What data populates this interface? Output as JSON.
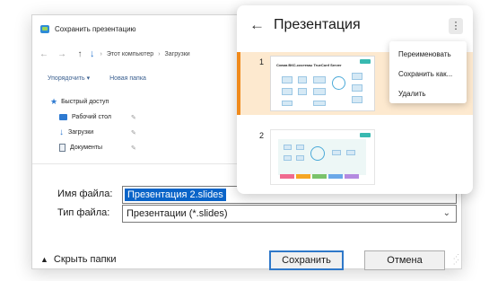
{
  "dialog": {
    "title": "Сохранить презентацию",
    "nav": {
      "back": "←",
      "forward": "→",
      "up": "↑",
      "breadcrumb": [
        "Этот компьютер",
        "Загрузки"
      ],
      "separator": "›"
    },
    "commands": [
      "Упорядочить ▾",
      "Новая папка"
    ],
    "tree": {
      "root": "Быстрый доступ",
      "items": [
        "Рабочий стол",
        "Загрузки",
        "Документы"
      ]
    },
    "filename_label": "Имя файла:",
    "filename_value": "Презентация 2.slides",
    "filetype_label": "Тип файла:",
    "filetype_value": "Презентации (*.slides)",
    "hide_folders": "Скрыть папки",
    "save_button": "Сохранить",
    "cancel_button": "Отмена"
  },
  "panel": {
    "back": "←",
    "title": "Презентация",
    "kebab": "⋮",
    "slides": [
      {
        "number": "1",
        "thumb_title": "Схема ВКС-системы TrueConf Server",
        "active": true
      },
      {
        "number": "2",
        "active": false
      }
    ]
  },
  "menu": {
    "items": [
      "Переименовать",
      "Сохранить как...",
      "Удалить"
    ]
  },
  "colors": {
    "accent_orange": "#f08a1c",
    "selection_blue": "#0a64c8",
    "active_row": "#fde9cf"
  }
}
